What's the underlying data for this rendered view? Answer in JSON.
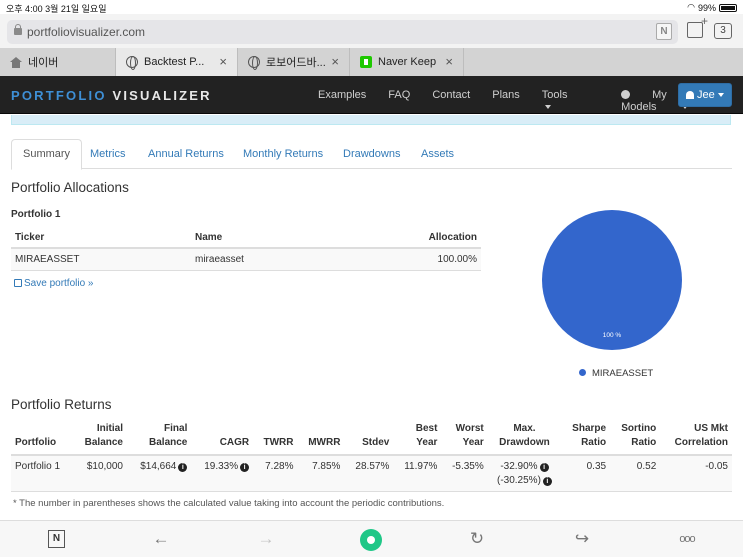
{
  "status": {
    "time_date": "오후 4:00   3월 21일 일요일",
    "battery": "99%"
  },
  "browser": {
    "url": "portfoliovisualizer.com",
    "reader_badge": "N",
    "tab_count": "3",
    "tabs": [
      {
        "label": "네이버"
      },
      {
        "label": "Backtest P..."
      },
      {
        "label": "로보어드바..."
      },
      {
        "label": "Naver Keep"
      }
    ]
  },
  "site": {
    "brand_part1": "PORTFOLIO",
    "brand_part2": "VISUALIZER",
    "nav": {
      "examples": "Examples",
      "faq": "FAQ",
      "contact": "Contact",
      "plans": "Plans",
      "tools": "Tools",
      "my_models": "My Models",
      "user": "Jee"
    }
  },
  "page_tabs": {
    "summary": "Summary",
    "metrics": "Metrics",
    "annual_returns": "Annual Returns",
    "monthly_returns": "Monthly Returns",
    "drawdowns": "Drawdowns",
    "assets": "Assets"
  },
  "allocations": {
    "heading": "Portfolio Allocations",
    "portfolio_label": "Portfolio 1",
    "headers": {
      "ticker": "Ticker",
      "name": "Name",
      "allocation": "Allocation"
    },
    "rows": [
      {
        "ticker": "MIRAEASSET",
        "name": "miraeasset",
        "allocation": "100.00%"
      }
    ],
    "save_link": "Save portfolio »"
  },
  "chart_data": {
    "type": "pie",
    "categories": [
      "MIRAEASSET"
    ],
    "values": [
      100
    ],
    "slice_label": "100 %",
    "legend": [
      "MIRAEASSET"
    ],
    "legend_position": "bottom",
    "colors": [
      "#3366cc"
    ]
  },
  "returns": {
    "heading": "Portfolio Returns",
    "headers": {
      "portfolio": "Portfolio",
      "initial_1": "Initial",
      "initial_2": "Balance",
      "final_1": "Final",
      "final_2": "Balance",
      "cagr": "CAGR",
      "twrr": "TWRR",
      "mwrr": "MWRR",
      "stdev": "Stdev",
      "best_1": "Best",
      "best_2": "Year",
      "worst_1": "Worst",
      "worst_2": "Year",
      "maxdd_1": "Max.",
      "maxdd_2": "Drawdown",
      "sharpe_1": "Sharpe",
      "sharpe_2": "Ratio",
      "sortino_1": "Sortino",
      "sortino_2": "Ratio",
      "usmkt_1": "US Mkt",
      "usmkt_2": "Correlation"
    },
    "row": {
      "portfolio": "Portfolio 1",
      "initial": "$10,000",
      "final": "$14,664",
      "cagr": "19.33%",
      "twrr": "7.28%",
      "mwrr": "7.85%",
      "stdev": "28.57%",
      "best": "11.97%",
      "worst": "-5.35%",
      "maxdd": "-32.90%",
      "maxdd_periodic": "(-30.25%)",
      "sharpe": "0.35",
      "sortino": "0.52",
      "usmkt": "-0.05"
    },
    "footnote": "* The number in parentheses shows the calculated value taking into account the periodic contributions."
  },
  "info_glyph": "i",
  "toolbar": {
    "n_label": "N",
    "back": "←",
    "forward": "→",
    "reload": "↻",
    "share": "↪",
    "more": "ooo"
  }
}
